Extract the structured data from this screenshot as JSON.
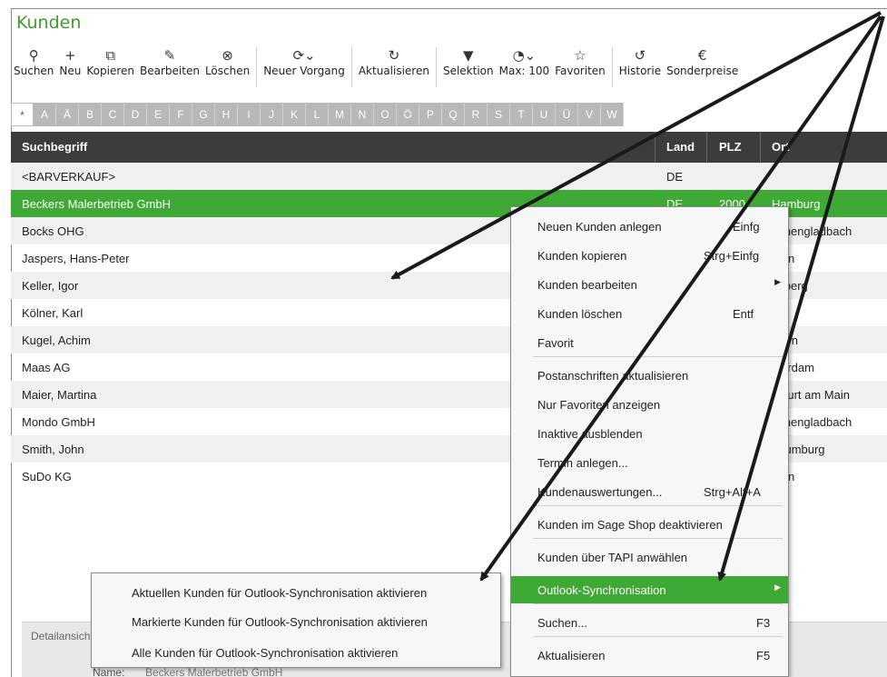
{
  "window": {
    "title": "Kunden"
  },
  "toolbar": [
    {
      "label": "Suchen",
      "icon": "search-icon",
      "glyph": "⚲"
    },
    {
      "label": "Neu",
      "icon": "plus-icon",
      "glyph": "+"
    },
    {
      "label": "Kopieren",
      "icon": "copy-icon",
      "glyph": "⧉"
    },
    {
      "label": "Bearbeiten",
      "icon": "edit-icon",
      "glyph": "✎"
    },
    {
      "label": "Löschen",
      "icon": "delete-icon",
      "glyph": "⊗"
    },
    {
      "label": "Neuer Vorgang",
      "icon": "new-process-icon",
      "glyph": "⟳⌄"
    },
    {
      "label": "Aktualisieren",
      "icon": "refresh-icon",
      "glyph": "↻"
    },
    {
      "label": "Selektion",
      "icon": "filter-icon",
      "glyph": "▼"
    },
    {
      "label": "Max: 100",
      "icon": "gauge-icon",
      "glyph": "◔⌄"
    },
    {
      "label": "Favoriten",
      "icon": "star-icon",
      "glyph": "☆"
    },
    {
      "label": "Historie",
      "icon": "history-icon",
      "glyph": "↺"
    },
    {
      "label": "Sonderpreise",
      "icon": "special-price-icon",
      "glyph": "€"
    }
  ],
  "alphabet": [
    "*",
    "A",
    "Ä",
    "B",
    "C",
    "D",
    "E",
    "F",
    "G",
    "H",
    "I",
    "J",
    "K",
    "L",
    "M",
    "N",
    "O",
    "Ö",
    "P",
    "Q",
    "R",
    "S",
    "T",
    "U",
    "Ü",
    "V",
    "W"
  ],
  "grid": {
    "columns": [
      "Suchbegriff",
      "Land",
      "PLZ",
      "Ort"
    ],
    "rows": [
      {
        "name": "<BARVERKAUF>",
        "land": "DE",
        "ort": ""
      },
      {
        "name": "Beckers Malerbetrieb GmbH",
        "land": "DE",
        "plz": "2000",
        "ort": "Hamburg",
        "selected": true
      },
      {
        "name": "Bocks OHG",
        "ort": "nchengladbach"
      },
      {
        "name": "Jaspers, Hans-Peter",
        "ort": "rsen"
      },
      {
        "name": "Keller, Igor",
        "ort": "nsberg"
      },
      {
        "name": "Kölner, Karl",
        "ort": "n"
      },
      {
        "name": "Kugel, Achim",
        "ort": "ggen"
      },
      {
        "name": "Maas AG",
        "ort": "sterdam"
      },
      {
        "name": "Maier, Martina",
        "ort": "nkfurt am Main"
      },
      {
        "name": "Mondo GmbH",
        "ort": "nchengladbach"
      },
      {
        "name": "Smith, John",
        "ort": "haumburg"
      },
      {
        "name": "SuDo KG",
        "ort": "rsen"
      }
    ]
  },
  "context_menu": [
    {
      "label": "Neuen Kunden anlegen",
      "shortcut": "Einfg"
    },
    {
      "label": "Kunden kopieren",
      "shortcut": "Strg+Einfg"
    },
    {
      "label": "Kunden bearbeiten",
      "submenu": true
    },
    {
      "label": "Kunden löschen",
      "shortcut": "Entf"
    },
    {
      "label": "Favorit"
    },
    {
      "label": "Postanschriften aktualisieren"
    },
    {
      "label": "Nur Favoriten anzeigen"
    },
    {
      "label": "Inaktive ausblenden"
    },
    {
      "label": "Termin anlegen..."
    },
    {
      "label": "Kundenauswertungen...",
      "shortcut": "Strg+Alt+A"
    },
    {
      "label": "Kunden im Sage Shop deaktivieren"
    },
    {
      "label": "Kunden über TAPI anwählen"
    },
    {
      "label": "Outlook-Synchronisation",
      "submenu": true,
      "highlighted": true
    },
    {
      "label": "Suchen...",
      "shortcut": "F3"
    },
    {
      "label": "Aktualisieren",
      "shortcut": "F5"
    }
  ],
  "submenu": [
    "Aktuellen Kunden für Outlook-Synchronisation aktivieren",
    "Markierte Kunden für Outlook-Synchronisation aktivieren",
    "Alle Kunden für Outlook-Synchronisation aktivieren"
  ],
  "detail": {
    "label": "Detailansicht",
    "name_label": "Name:",
    "name_value": "Beckers Malerbetrieb GmbH"
  },
  "colors": {
    "accent": "#3fa935",
    "title": "#3f9b2b",
    "header": "#3c3c3c"
  }
}
